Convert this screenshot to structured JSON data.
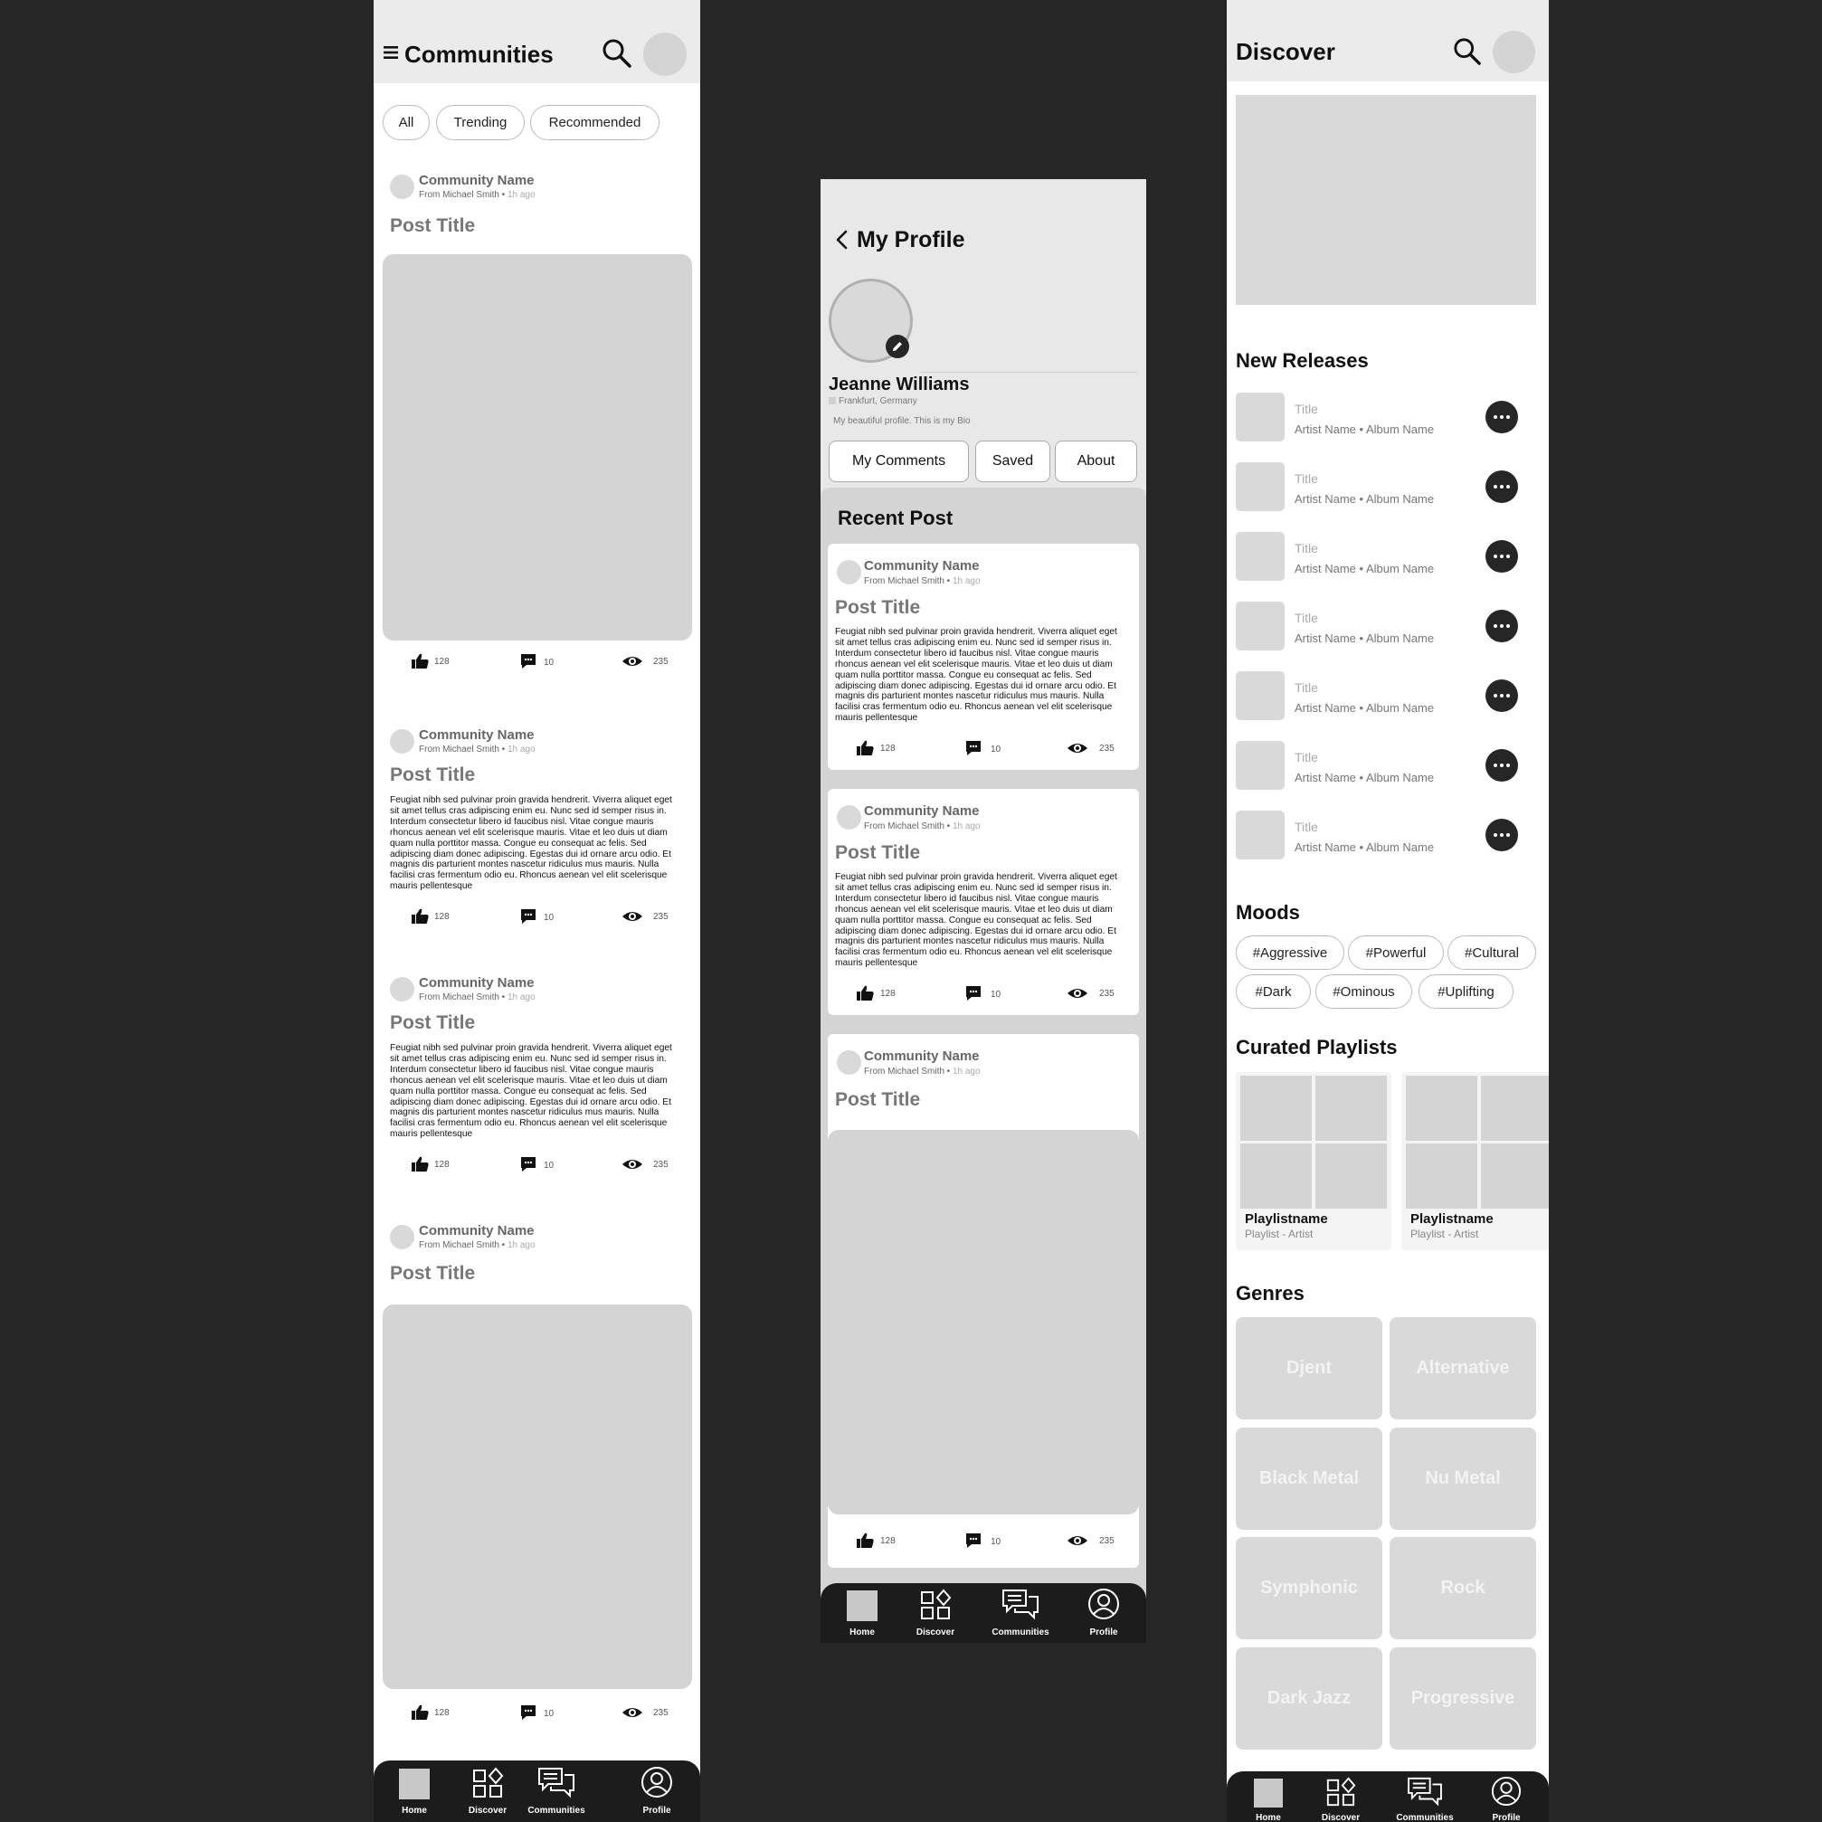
{
  "post_body": "Feugiat nibh sed pulvinar proin gravida hendrerit. Viverra aliquet eget sit amet tellus cras adipiscing enim eu. Nunc sed id semper risus in. Interdum consectetur libero id faucibus nisl. Vitae congue mauris rhoncus aenean vel elit scelerisque mauris. Vitae et leo duis ut diam quam nulla porttitor massa. Congue eu consequat ac felis. Sed adipiscing diam donec adipiscing. Egestas dui id ornare arcu odio. Et magnis dis parturient montes nascetur ridiculus mus mauris. Nulla facilisi cras fermentum odio eu. Rhoncus aenean vel elit scelerisque mauris pellentesque",
  "communities": {
    "title": "Communities",
    "filters": [
      "All",
      "Trending",
      "Recommended"
    ],
    "posts": [
      {
        "community": "Community Name",
        "from": "From Michael Smith •",
        "ago": "1h ago",
        "title": "Post Title",
        "likes": "128",
        "comments": "10",
        "views": "235"
      },
      {
        "community": "Community Name",
        "from": "From Michael Smith •",
        "ago": "1h ago",
        "title": "Post Title",
        "likes": "128",
        "comments": "10",
        "views": "235"
      },
      {
        "community": "Community Name",
        "from": "From Michael Smith •",
        "ago": "1h ago",
        "title": "Post Title",
        "likes": "128",
        "comments": "10",
        "views": "235"
      },
      {
        "community": "Community Name",
        "from": "From Michael Smith •",
        "ago": "1h ago",
        "title": "Post Title",
        "likes": "128",
        "comments": "10",
        "views": "235"
      }
    ]
  },
  "profile": {
    "title": "My Profile",
    "name": "Jeanne Williams",
    "location": "Frankfurt, Germany",
    "bio": "My beautiful profile. This is my Bio",
    "tabs": [
      "My Comments",
      "Saved",
      "About"
    ],
    "recent_title": "Recent Post",
    "posts": [
      {
        "community": "Community Name",
        "from": "From Michael Smith •",
        "ago": "1h ago",
        "title": "Post Title",
        "likes": "128",
        "comments": "10",
        "views": "235"
      },
      {
        "community": "Community Name",
        "from": "From Michael Smith •",
        "ago": "1h ago",
        "title": "Post Title",
        "likes": "128",
        "comments": "10",
        "views": "235"
      },
      {
        "community": "Community Name",
        "from": "From Michael Smith •",
        "ago": "1h ago",
        "title": "Post Title",
        "likes": "128",
        "comments": "10",
        "views": "235"
      }
    ]
  },
  "discover": {
    "title": "Discover",
    "new_releases_title": "New Releases",
    "releases": [
      {
        "title": "Title",
        "sub": "Artist Name • Album Name"
      },
      {
        "title": "Title",
        "sub": "Artist Name • Album Name"
      },
      {
        "title": "Title",
        "sub": "Artist Name • Album Name"
      },
      {
        "title": "Title",
        "sub": "Artist Name • Album Name"
      },
      {
        "title": "Title",
        "sub": "Artist Name • Album Name"
      },
      {
        "title": "Title",
        "sub": "Artist Name • Album Name"
      },
      {
        "title": "Title",
        "sub": "Artist Name • Album Name"
      }
    ],
    "moods_title": "Moods",
    "moods": [
      "#Aggressive",
      "#Powerful",
      "#Cultural",
      "#Dark",
      "#Ominous",
      "#Uplifting"
    ],
    "playlists_title": "Curated Playlists",
    "playlists": [
      {
        "name": "Playlistname",
        "sub": "Playlist - Artist"
      },
      {
        "name": "Playlistname",
        "sub": "Playlist - Artist"
      }
    ],
    "genres_title": "Genres",
    "genres": [
      "Djent",
      "Alternative",
      "Black Metal",
      "Nu Metal",
      "Symphonic",
      "Rock",
      "Dark Jazz",
      "Progressive"
    ]
  },
  "nav": [
    "Home",
    "Discover",
    "Communities",
    "Profile"
  ],
  "icons": {
    "menu": "menu-icon",
    "search": "search-icon",
    "back": "chevron-left-icon",
    "edit": "pencil-icon",
    "like": "thumbs-up-icon",
    "comment": "comment-icon",
    "views": "eye-icon",
    "more": "more-horizontal-icon",
    "nav": [
      "home-icon",
      "discover-grid-icon",
      "chat-bubbles-icon",
      "user-circle-icon"
    ]
  }
}
